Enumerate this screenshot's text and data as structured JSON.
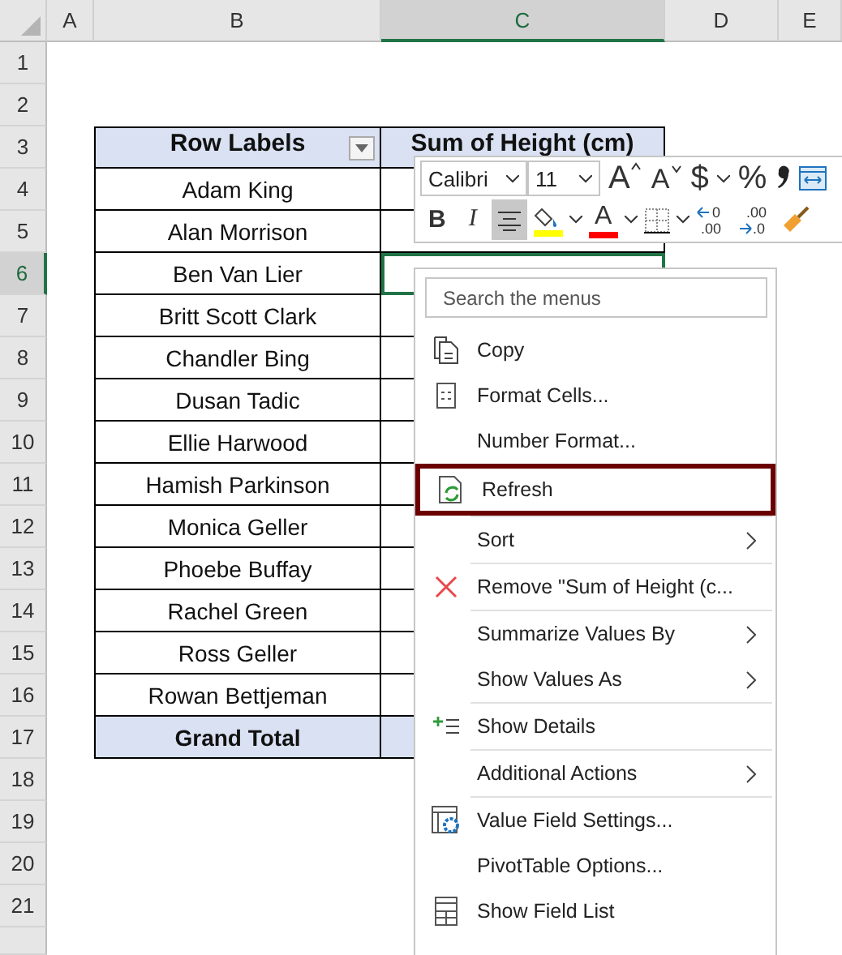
{
  "sheet": {
    "columns": [
      {
        "label": "A",
        "selected": false
      },
      {
        "label": "B",
        "selected": false
      },
      {
        "label": "C",
        "selected": true
      },
      {
        "label": "D",
        "selected": false
      },
      {
        "label": "E",
        "selected": false
      }
    ],
    "rows": [
      {
        "label": "1",
        "selected": false
      },
      {
        "label": "2",
        "selected": false
      },
      {
        "label": "3",
        "selected": false
      },
      {
        "label": "4",
        "selected": false
      },
      {
        "label": "5",
        "selected": false
      },
      {
        "label": "6",
        "selected": true
      },
      {
        "label": "7",
        "selected": false
      },
      {
        "label": "8",
        "selected": false
      },
      {
        "label": "9",
        "selected": false
      },
      {
        "label": "10",
        "selected": false
      },
      {
        "label": "11",
        "selected": false
      },
      {
        "label": "12",
        "selected": false
      },
      {
        "label": "13",
        "selected": false
      },
      {
        "label": "14",
        "selected": false
      },
      {
        "label": "15",
        "selected": false
      },
      {
        "label": "16",
        "selected": false
      },
      {
        "label": "17",
        "selected": false
      },
      {
        "label": "18",
        "selected": false
      },
      {
        "label": "19",
        "selected": false
      },
      {
        "label": "20",
        "selected": false
      },
      {
        "label": "21",
        "selected": false
      }
    ]
  },
  "pivot": {
    "row_header": "Row Labels",
    "value_header": "Sum of Height (cm)",
    "names": [
      "Adam King",
      "Alan Morrison",
      "Ben Van Lier",
      "Britt Scott Clark",
      "Chandler Bing",
      "Dusan Tadic",
      "Ellie Harwood",
      "Hamish Parkinson",
      "Monica Geller",
      "Phoebe Buffay",
      "Rachel Green",
      "Ross Geller",
      "Rowan Bettjeman"
    ],
    "total": "Grand Total"
  },
  "mini_toolbar": {
    "font": "Calibri",
    "size": "11",
    "grow_font": "A",
    "shrink_font": "A",
    "currency": "$",
    "percent": "%",
    "bold": "B",
    "italic": "I",
    "center_align": {
      "selected": true
    },
    "font_color_label": "A",
    "increase_decimal": [
      "0",
      ".00"
    ],
    "decrease_decimal": [
      ".00",
      ".0"
    ]
  },
  "context_menu": {
    "search_placeholder": "Search the menus",
    "items": [
      {
        "label": "Copy",
        "separator_before": false,
        "submenu": false,
        "highlighted": false
      },
      {
        "label": "Format Cells...",
        "separator_before": false,
        "submenu": false,
        "highlighted": false
      },
      {
        "label": "Number Format...",
        "separator_before": false,
        "submenu": false,
        "highlighted": false
      },
      {
        "label": "Refresh",
        "separator_before": false,
        "submenu": false,
        "highlighted": true
      },
      {
        "label": "Sort",
        "separator_before": true,
        "submenu": true,
        "highlighted": false
      },
      {
        "label": "Remove \"Sum of Height (c...",
        "separator_before": true,
        "submenu": false,
        "highlighted": false
      },
      {
        "label": "Summarize Values By",
        "separator_before": true,
        "submenu": true,
        "highlighted": false
      },
      {
        "label": "Show Values As",
        "separator_before": false,
        "submenu": true,
        "highlighted": false
      },
      {
        "label": "Show Details",
        "separator_before": true,
        "submenu": false,
        "highlighted": false
      },
      {
        "label": "Additional Actions",
        "separator_before": true,
        "submenu": true,
        "highlighted": false
      },
      {
        "label": "Value Field Settings...",
        "separator_before": true,
        "submenu": false,
        "highlighted": false
      },
      {
        "label": "PivotTable Options...",
        "separator_before": false,
        "submenu": false,
        "highlighted": false
      },
      {
        "label": "Show Field List",
        "separator_before": false,
        "submenu": false,
        "highlighted": false
      }
    ]
  }
}
